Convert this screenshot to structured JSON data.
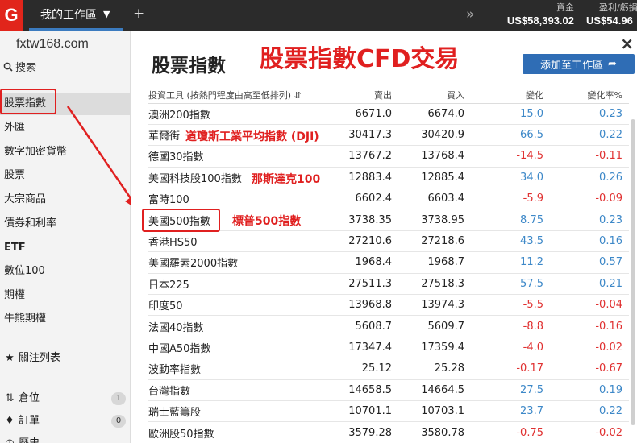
{
  "topbar": {
    "logo": "G",
    "workspace_tab": "我的工作區",
    "add_tab": "+",
    "more": "»",
    "cash_label": "資金",
    "cash_value": "US$58,393.02",
    "pl_label": "盈利/虧損",
    "pl_value": "US$54.96"
  },
  "sidebar": {
    "site_url": "fxtw168.com",
    "search_label": "搜索",
    "items": [
      {
        "label": "股票指數"
      },
      {
        "label": "外匯"
      },
      {
        "label": "數字加密貨幣"
      },
      {
        "label": "股票"
      },
      {
        "label": "大宗商品"
      },
      {
        "label": "債券和利率"
      },
      {
        "label": "ETF"
      },
      {
        "label": "數位100"
      },
      {
        "label": "期權"
      },
      {
        "label": "牛熊期權"
      },
      {
        "label": "關注列表"
      },
      {
        "label": "倉位",
        "badge": "1"
      },
      {
        "label": "訂單",
        "badge": "0"
      },
      {
        "label": "歷史"
      }
    ]
  },
  "main": {
    "title": "股票指數",
    "annotation_title": "股票指數CFD交易",
    "add_button": "添加至工作區",
    "close": "×",
    "columns": {
      "name": "投資工具 (按熱門程度由高至低排列)",
      "bid": "賣出",
      "ask": "買入",
      "change": "變化",
      "change_pct": "變化率%"
    },
    "rows": [
      {
        "name": "澳洲200指數",
        "bid": "6671.0",
        "ask": "6674.0",
        "change": "15.0",
        "pct": "0.23",
        "dir": "pos"
      },
      {
        "name": "華爾街",
        "note": "道瓊斯工業平均指數 (DJI)",
        "bid": "30417.3",
        "ask": "30420.9",
        "change": "66.5",
        "pct": "0.22",
        "dir": "pos"
      },
      {
        "name": "德國30指數",
        "bid": "13767.2",
        "ask": "13768.4",
        "change": "-14.5",
        "pct": "-0.11",
        "dir": "neg"
      },
      {
        "name": "美國科技股100指數",
        "note": "那斯達克100",
        "bid": "12883.4",
        "ask": "12885.4",
        "change": "34.0",
        "pct": "0.26",
        "dir": "pos"
      },
      {
        "name": "富時100",
        "bid": "6602.4",
        "ask": "6603.4",
        "change": "-5.9",
        "pct": "-0.09",
        "dir": "neg"
      },
      {
        "name": "美國500指數",
        "note": "標普500指數",
        "bid": "3738.35",
        "ask": "3738.95",
        "change": "8.75",
        "pct": "0.23",
        "dir": "pos"
      },
      {
        "name": "香港HS50",
        "bid": "27210.6",
        "ask": "27218.6",
        "change": "43.5",
        "pct": "0.16",
        "dir": "pos"
      },
      {
        "name": "美國羅素2000指數",
        "bid": "1968.4",
        "ask": "1968.7",
        "change": "11.2",
        "pct": "0.57",
        "dir": "pos"
      },
      {
        "name": "日本225",
        "bid": "27511.3",
        "ask": "27518.3",
        "change": "57.5",
        "pct": "0.21",
        "dir": "pos"
      },
      {
        "name": "印度50",
        "bid": "13968.8",
        "ask": "13974.3",
        "change": "-5.5",
        "pct": "-0.04",
        "dir": "neg"
      },
      {
        "name": "法國40指數",
        "bid": "5608.7",
        "ask": "5609.7",
        "change": "-8.8",
        "pct": "-0.16",
        "dir": "neg"
      },
      {
        "name": "中國A50指數",
        "bid": "17347.4",
        "ask": "17359.4",
        "change": "-4.0",
        "pct": "-0.02",
        "dir": "neg"
      },
      {
        "name": "波動率指數",
        "bid": "25.12",
        "ask": "25.28",
        "change": "-0.17",
        "pct": "-0.67",
        "dir": "neg"
      },
      {
        "name": "台灣指數",
        "bid": "14658.5",
        "ask": "14664.5",
        "change": "27.5",
        "pct": "0.19",
        "dir": "pos"
      },
      {
        "name": "瑞士藍籌股",
        "bid": "10701.1",
        "ask": "10703.1",
        "change": "23.7",
        "pct": "0.22",
        "dir": "pos"
      },
      {
        "name": "歐洲股50指數",
        "bid": "3579.28",
        "ask": "3580.78",
        "change": "-0.75",
        "pct": "-0.02",
        "dir": "neg"
      }
    ]
  },
  "colors": {
    "positive": "#3d88c8",
    "negative": "#e03030",
    "annotation": "#e02020",
    "brand": "#e1251b",
    "button": "#2f6db5"
  }
}
